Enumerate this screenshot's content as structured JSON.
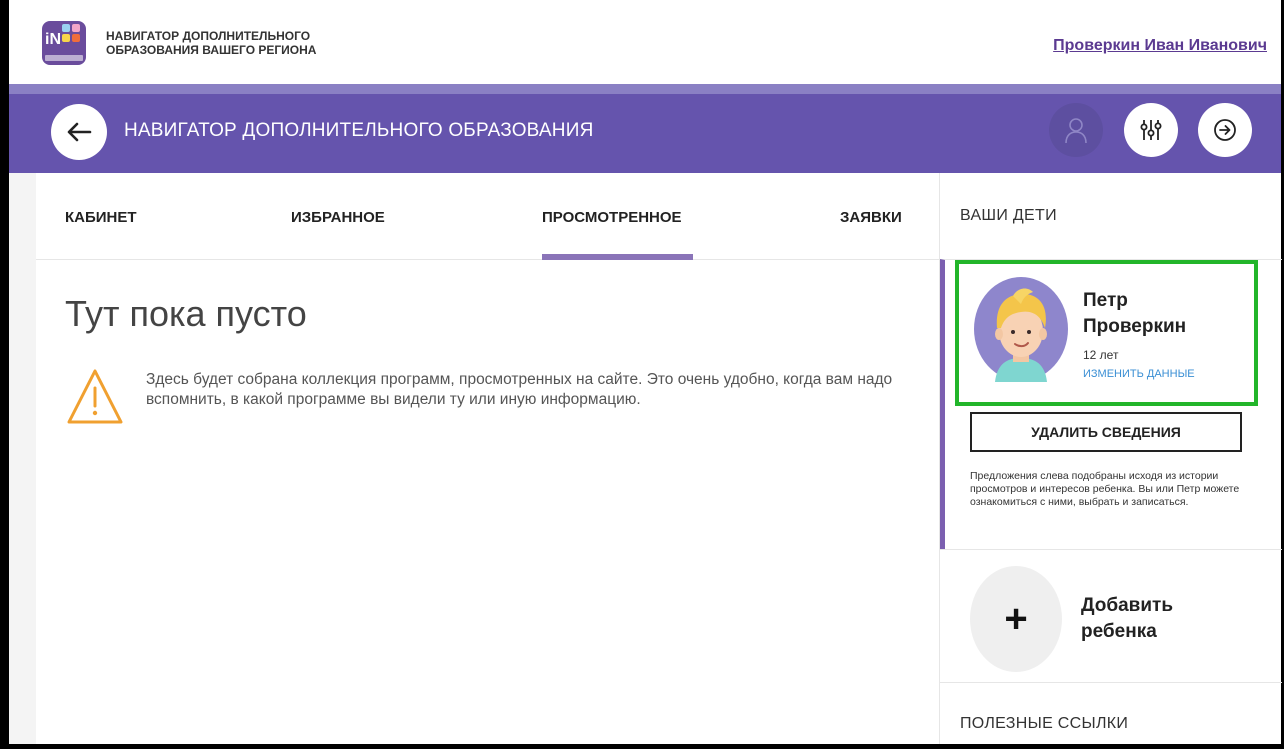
{
  "header": {
    "site_title_line1": "НАВИГАТОР ДОПОЛНИТЕЛЬНОГО",
    "site_title_line2": "ОБРАЗОВАНИЯ ВАШЕГО РЕГИОНА",
    "logo_text": "iN",
    "user_name": "Проверкин Иван Иванович"
  },
  "band": {
    "title": "НАВИГАТОР ДОПОЛНИТЕЛЬНОГО ОБРАЗОВАНИЯ"
  },
  "tabs": [
    {
      "label": "КАБИНЕТ",
      "active": false
    },
    {
      "label": "ИЗБРАННОЕ",
      "active": false
    },
    {
      "label": "ПРОСМОТРЕННОЕ",
      "active": true
    },
    {
      "label": "ЗАЯВКИ",
      "active": false
    }
  ],
  "empty_state": {
    "title": "Тут пока пусто",
    "text": "Здесь будет собрана коллекция программ, просмотренных на сайте. Это очень удобно, когда вам надо вспомнить, в какой программе вы видели ту или иную информацию."
  },
  "sidebar": {
    "heading": "ВАШИ ДЕТИ",
    "child": {
      "first_name": "Петр",
      "last_name": "Проверкин",
      "age": "12 лет",
      "edit_label": "ИЗМЕНИТЬ ДАННЫЕ"
    },
    "delete_label": "УДАЛИТЬ СВЕДЕНИЯ",
    "hint": "Предложения слева подобраны исходя из истории просмотров и интересов ребенка. Вы или Петр можете ознакомиться с ними, выбрать и записаться.",
    "add_child_line1": "Добавить",
    "add_child_line2": "ребенка",
    "add_icon": "+",
    "links_heading": "ПОЛЕЗНЫЕ ССЫЛКИ"
  },
  "colors": {
    "brand_purple": "#6554ad",
    "accent_purple": "#7b5fb0",
    "highlight_green": "#22b52a",
    "link_blue": "#3b8fd4",
    "warning_orange": "#f0a030"
  },
  "icons": {
    "back": "arrow-left-icon",
    "avatar": "user-icon",
    "filters": "sliders-icon",
    "exit": "exit-arrow-icon",
    "warning": "warning-triangle-icon",
    "add": "plus-icon"
  }
}
